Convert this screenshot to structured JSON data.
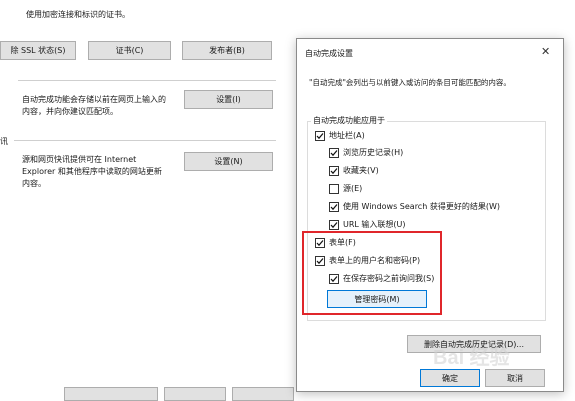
{
  "bg": {
    "cert_desc": "使用加密连接和标识的证书。",
    "buttons": {
      "clear_ssl": "除 SSL 状态(S)",
      "certificates": "证书(C)",
      "publishers": "发布者(B)",
      "autocomplete_settings": "设置(I)",
      "feeds_settings": "设置(N)"
    },
    "autocomplete_desc": [
      "自动完成功能会存储以前在网页上输入的",
      "内容，并向你建议匹配项。"
    ],
    "feeds_header": "讯",
    "feeds_desc": [
      "源和网页快讯提供可在 Internet",
      "Explorer 和其他程序中读取的网站更新",
      "内容。"
    ]
  },
  "dialog": {
    "title": "自动完成设置",
    "close_glyph": "✕",
    "intro": "\"自动完成\"会列出与以前键入或访问的条目可能匹配的内容。",
    "group_label": "自动完成功能应用于",
    "checkboxes": [
      {
        "label": "地址栏(A)",
        "checked": true
      },
      {
        "label": "浏览历史记录(H)",
        "checked": true
      },
      {
        "label": "收藏夹(V)",
        "checked": true
      },
      {
        "label": "源(E)",
        "checked": false
      },
      {
        "label": "使用 Windows Search 获得更好的结果(W)",
        "checked": true
      },
      {
        "label": "URL 输入联想(U)",
        "checked": true
      },
      {
        "label": "表单(F)",
        "checked": true
      },
      {
        "label": "表单上的用户名和密码(P)",
        "checked": true
      },
      {
        "label": "在保存密码之前询问我(S)",
        "checked": true
      }
    ],
    "manage_passwords": "管理密码(M)",
    "delete_history": "删除自动完成历史记录(D)...",
    "ok": "确定",
    "cancel": "取消"
  },
  "watermark": "Bai 经验",
  "colors": {
    "highlight_border": "#e0262b",
    "focus_border": "#0078d7",
    "button_bg": "#e1e1e1"
  }
}
